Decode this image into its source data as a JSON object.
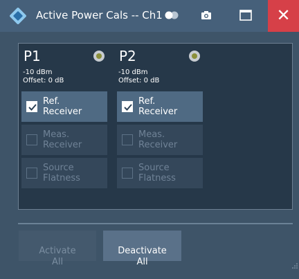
{
  "window": {
    "title": "Active Power Cals -- Ch1",
    "icons": [
      "app-logo-icon",
      "toggle-icon",
      "camera-icon",
      "maximize-icon",
      "close-icon"
    ],
    "close_label": "✕",
    "close_color": "#d64048",
    "background": "#3e5468"
  },
  "ports": [
    {
      "name": "P1",
      "power": "-10 dBm",
      "offset": "Offset: 0 dB",
      "buttons": [
        {
          "label": "Ref.\nReceiver",
          "checked": true,
          "enabled": true
        },
        {
          "label": "Meas.\nReceiver",
          "checked": false,
          "enabled": false
        },
        {
          "label": "Source\nFlatness",
          "checked": false,
          "enabled": false
        }
      ]
    },
    {
      "name": "P2",
      "power": "-10 dBm",
      "offset": "Offset: 0 dB",
      "buttons": [
        {
          "label": "Ref.\nReceiver",
          "checked": true,
          "enabled": true
        },
        {
          "label": "Meas.\nReceiver",
          "checked": false,
          "enabled": false
        },
        {
          "label": "Source\nFlatness",
          "checked": false,
          "enabled": false
        }
      ]
    }
  ],
  "actions": {
    "activate_all": "Activate\nAll",
    "deactivate_all": "Deactivate\nAll"
  }
}
